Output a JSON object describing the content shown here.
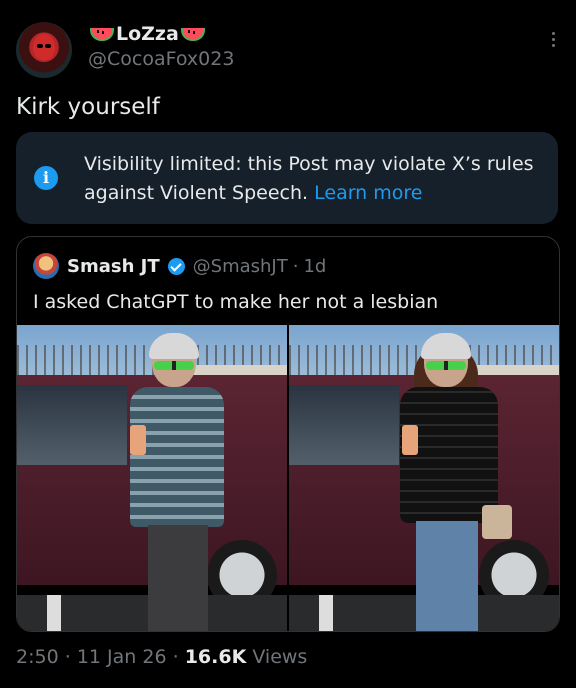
{
  "author": {
    "display_name": "LoZza",
    "handle": "@CocoaFox023"
  },
  "tweet": {
    "text": "Kirk yourself"
  },
  "notice": {
    "text": "Visibility limited: this Post may violate X’s rules against Violent Speech.",
    "link": "Learn more"
  },
  "quote": {
    "name": "Smash JT",
    "handle": "@SmashJT",
    "separator": "·",
    "age": "1d",
    "text": "I asked ChatGPT to make her not a lesbian"
  },
  "meta": {
    "time": "2:50",
    "sep1": "·",
    "date": "11 Jan 26",
    "sep2": "·",
    "views_count": "16.6K",
    "views_label": "Views"
  },
  "colors": {
    "accent": "#1d9bf0",
    "background": "#000000",
    "notice_bg": "#16202a"
  }
}
